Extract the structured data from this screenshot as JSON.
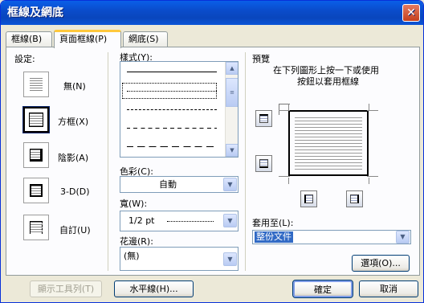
{
  "window": {
    "title": "框線及網底",
    "close_icon": "close-icon"
  },
  "tabs": [
    {
      "label": "框線(B)"
    },
    {
      "label": "頁面框線(P)"
    },
    {
      "label": "網底(S)"
    }
  ],
  "settings": {
    "heading": "設定:",
    "items": [
      {
        "label": "無(N)"
      },
      {
        "label": "方框(X)"
      },
      {
        "label": "陰影(A)"
      },
      {
        "label": "3-D(D)"
      },
      {
        "label": "自訂(U)"
      }
    ]
  },
  "style": {
    "label": "樣式(Y):"
  },
  "color": {
    "label": "色彩(C):",
    "value": "自動"
  },
  "width": {
    "label": "寬(W):",
    "value": "1/2 pt"
  },
  "art": {
    "label": "花邊(R):",
    "value": "(無)"
  },
  "preview": {
    "heading": "預覽",
    "instructions_line1": "在下列圖形上按一下或使用",
    "instructions_line2": "按鈕以套用框線"
  },
  "apply_to": {
    "label": "套用至(L):",
    "value": "整份文件"
  },
  "buttons": {
    "options": "選項(O)...",
    "show_toolbar": "顯示工具列(T)",
    "horizontal_line": "水平線(H)...",
    "ok": "確定",
    "cancel": "取消"
  }
}
